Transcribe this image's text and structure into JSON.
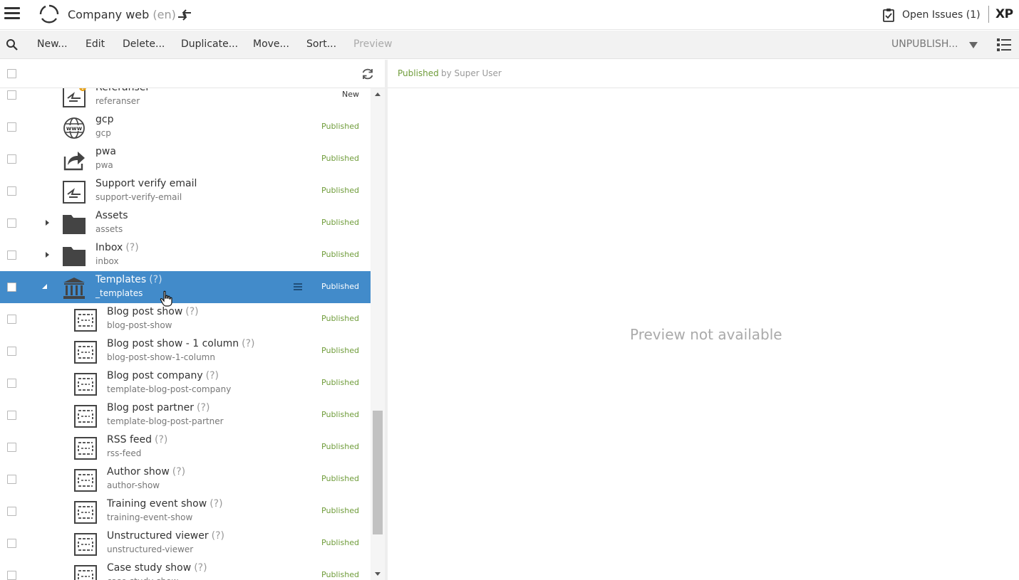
{
  "header": {
    "menu_icon": "hamburger-icon",
    "logo_icon": "enonic-logo-icon",
    "title": "Company web",
    "language": "(en)",
    "switch_icon": "switch-project-icon",
    "issues_icon": "clipboard-check-icon",
    "issues_label": "Open Issues (1)",
    "product_label": "XP"
  },
  "toolbar": {
    "search_icon": "search-icon",
    "buttons": [
      "New...",
      "Edit",
      "Delete...",
      "Duplicate...",
      "Move...",
      "Sort...",
      "Preview"
    ],
    "disabled_buttons": [
      "Preview"
    ],
    "publish_action": "UNPUBLISH...",
    "publish_menu_icon": "caret-down-icon",
    "view_toggle_icon": "list-view-icon"
  },
  "tree": {
    "refresh_icon": "refresh-icon",
    "rows": [
      {
        "name": "Referanser",
        "path": "referanser",
        "status": "New",
        "icon": "shortcut-alert-icon",
        "depth": 1,
        "toggle": "",
        "qmark": ""
      },
      {
        "name": "gcp",
        "path": "gcp",
        "status": "Published",
        "icon": "www-globe-icon",
        "depth": 1,
        "toggle": "",
        "qmark": ""
      },
      {
        "name": "pwa",
        "path": "pwa",
        "status": "Published",
        "icon": "share-arrow-icon",
        "depth": 1,
        "toggle": "",
        "qmark": ""
      },
      {
        "name": "Support verify email",
        "path": "support-verify-email",
        "status": "Published",
        "icon": "shortcut-icon",
        "depth": 1,
        "toggle": "",
        "qmark": ""
      },
      {
        "name": "Assets",
        "path": "assets",
        "status": "Published",
        "icon": "folder-icon",
        "depth": 1,
        "toggle": "collapsed",
        "qmark": ""
      },
      {
        "name": "Inbox",
        "path": "inbox",
        "status": "Published",
        "icon": "folder-icon",
        "depth": 1,
        "toggle": "collapsed",
        "qmark": "(?)"
      },
      {
        "name": "Templates",
        "path": "_templates",
        "status": "Published",
        "icon": "templates-building-icon",
        "depth": 1,
        "toggle": "expanded",
        "qmark": "(?)",
        "selected": true
      },
      {
        "name": "Blog post show",
        "path": "blog-post-show",
        "status": "Published",
        "icon": "page-template-icon",
        "depth": 2,
        "toggle": "",
        "qmark": "(?)"
      },
      {
        "name": "Blog post show - 1 column",
        "path": "blog-post-show-1-column",
        "status": "Published",
        "icon": "page-template-icon",
        "depth": 2,
        "toggle": "",
        "qmark": "(?)"
      },
      {
        "name": "Blog post company",
        "path": "template-blog-post-company",
        "status": "Published",
        "icon": "page-template-icon",
        "depth": 2,
        "toggle": "",
        "qmark": "(?)"
      },
      {
        "name": "Blog post partner",
        "path": "template-blog-post-partner",
        "status": "Published",
        "icon": "page-template-icon",
        "depth": 2,
        "toggle": "",
        "qmark": "(?)"
      },
      {
        "name": "RSS feed",
        "path": "rss-feed",
        "status": "Published",
        "icon": "page-template-icon",
        "depth": 2,
        "toggle": "",
        "qmark": "(?)"
      },
      {
        "name": "Author show",
        "path": "author-show",
        "status": "Published",
        "icon": "page-template-icon",
        "depth": 2,
        "toggle": "",
        "qmark": "(?)"
      },
      {
        "name": "Training event show",
        "path": "training-event-show",
        "status": "Published",
        "icon": "page-template-icon",
        "depth": 2,
        "toggle": "",
        "qmark": "(?)"
      },
      {
        "name": "Unstructured viewer",
        "path": "unstructured-viewer",
        "status": "Published",
        "icon": "page-template-icon",
        "depth": 2,
        "toggle": "",
        "qmark": "(?)"
      },
      {
        "name": "Case study show",
        "path": "case-study-show",
        "status": "Published",
        "icon": "page-template-icon",
        "depth": 2,
        "toggle": "",
        "qmark": "(?)"
      }
    ]
  },
  "preview": {
    "status": "Published",
    "by": "by Super User",
    "message": "Preview not available"
  },
  "colors": {
    "selected_row": "#428bca",
    "published_text": "#6f9c3a",
    "toolbar_bg": "#f2f2f2"
  }
}
